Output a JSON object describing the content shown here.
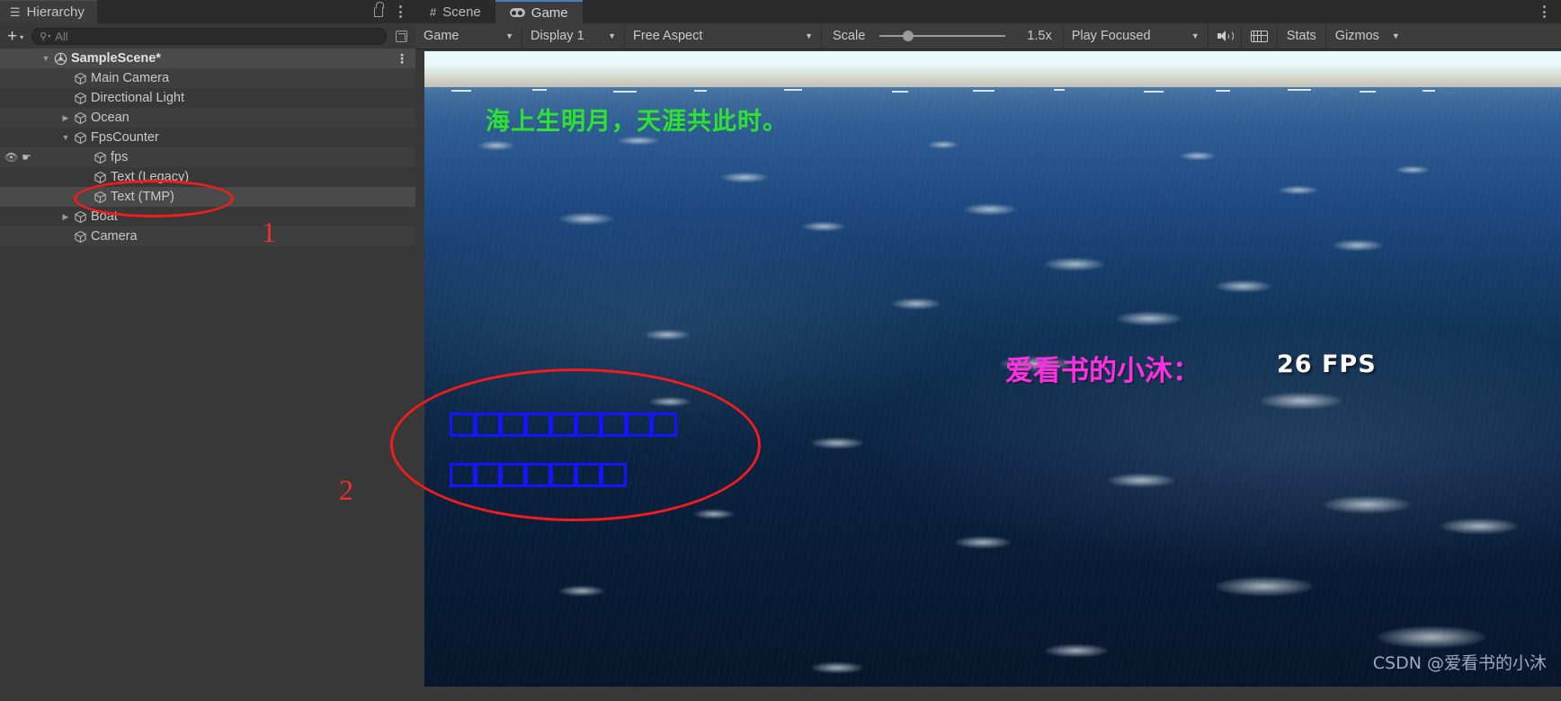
{
  "hierarchy": {
    "tab_label": "Hierarchy",
    "tab_icon": "hierarchy-list-icon",
    "lock_icon": "lock-open-icon",
    "menu_icon": "kebab-menu-icon",
    "add_button_label": "+",
    "add_button_caret": "▾",
    "search": {
      "icon": "search-magnifier-icon",
      "value": "",
      "placeholder": "All"
    },
    "popout_icon": "popout-window-icon",
    "rows": [
      {
        "label": "SampleScene*",
        "depth": 0,
        "twisty": "▼",
        "icon": "unity-scene-icon",
        "selected": true,
        "kebab": "⋮",
        "visibility": false,
        "pickability": false
      },
      {
        "label": "Main Camera",
        "depth": 1,
        "twisty": "",
        "icon": "gameobject-cube-icon",
        "selected": false,
        "kebab": "",
        "visibility": false,
        "pickability": false
      },
      {
        "label": "Directional Light",
        "depth": 1,
        "twisty": "",
        "icon": "gameobject-cube-icon",
        "selected": false,
        "kebab": "",
        "visibility": false,
        "pickability": false
      },
      {
        "label": "Ocean",
        "depth": 1,
        "twisty": "▶",
        "icon": "gameobject-cube-icon",
        "selected": false,
        "kebab": "",
        "visibility": false,
        "pickability": false
      },
      {
        "label": "FpsCounter",
        "depth": 1,
        "twisty": "▼",
        "icon": "gameobject-cube-icon",
        "selected": false,
        "kebab": "",
        "visibility": false,
        "pickability": false
      },
      {
        "label": "fps",
        "depth": 2,
        "twisty": "",
        "icon": "gameobject-cube-icon",
        "selected": false,
        "kebab": "",
        "visibility": true,
        "pickability": true
      },
      {
        "label": "Text (Legacy)",
        "depth": 2,
        "twisty": "",
        "icon": "gameobject-cube-icon",
        "selected": false,
        "kebab": "",
        "visibility": false,
        "pickability": false
      },
      {
        "label": "Text (TMP)",
        "depth": 2,
        "twisty": "",
        "icon": "gameobject-cube-icon",
        "selected": true,
        "kebab": "",
        "visibility": false,
        "pickability": false
      },
      {
        "label": "Boat",
        "depth": 1,
        "twisty": "▶",
        "icon": "gameobject-cube-icon",
        "selected": false,
        "kebab": "",
        "visibility": false,
        "pickability": false
      },
      {
        "label": "Camera",
        "depth": 1,
        "twisty": "",
        "icon": "gameobject-cube-icon",
        "selected": false,
        "kebab": "",
        "visibility": false,
        "pickability": false
      }
    ]
  },
  "game_panel": {
    "tabs": [
      {
        "label": "Scene",
        "icon": "grid-hash-icon",
        "active": false
      },
      {
        "label": "Game",
        "icon": "gamepad-icon",
        "active": true
      }
    ],
    "menu_icon": "kebab-menu-icon",
    "toolbar": {
      "view_mode": "Game",
      "view_mode_caret": "▼",
      "display": "Display 1",
      "display_caret": "▼",
      "aspect": "Free Aspect",
      "aspect_caret": "▼",
      "scale_label": "Scale",
      "scale_value": "1.5x",
      "scale_slider_percent": 19,
      "play_mode": "Play Focused",
      "play_mode_caret": "▼",
      "mute_audio_icon": "speaker-audio-icon",
      "input_icon": "keyboard-icon",
      "stats_label": "Stats",
      "gizmos_label": "Gizmos",
      "gizmos_caret": "▼"
    }
  },
  "game_view": {
    "poem_text": "海上生明月，天涯共此时。",
    "poem_color": "#2fe22f",
    "nickname_text": "爱看书的小沐：",
    "nickname_color": "#ff2fdf",
    "fps_text": "26 FPS",
    "fps_color": "#ffffff",
    "fps_value": 26,
    "missing_glyph_rows": [
      9,
      7
    ],
    "missing_glyph_color": "#1414ff",
    "watermark": "CSDN @爱看书的小沐"
  },
  "annotations": {
    "color": "#f11c1c",
    "marker_one": "1",
    "marker_two": "2"
  }
}
